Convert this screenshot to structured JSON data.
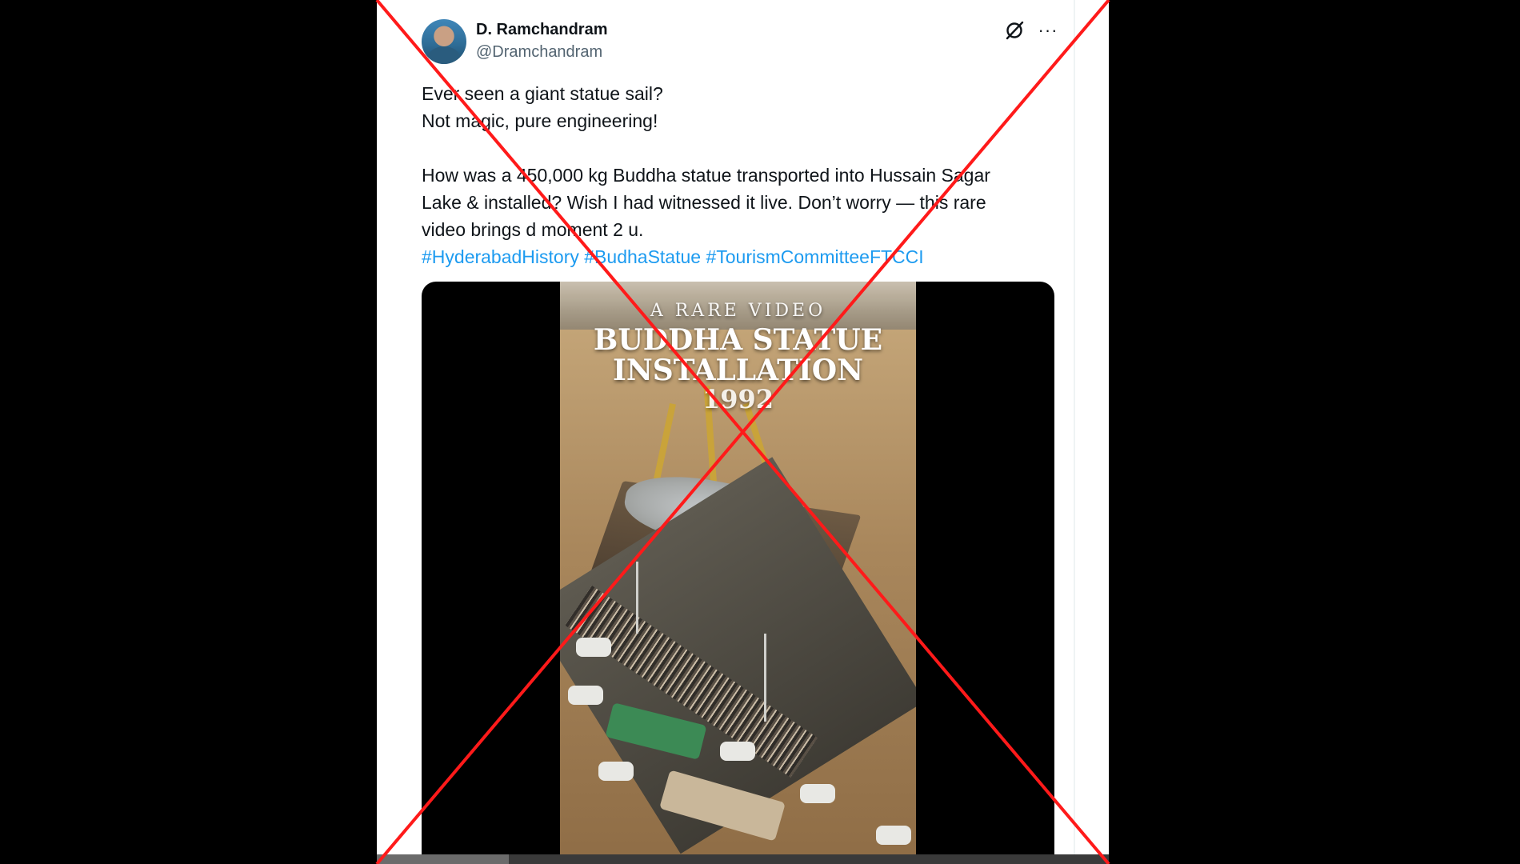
{
  "tweet": {
    "author": {
      "display_name": "D. Ramchandram",
      "handle": "@Dramchandram"
    },
    "text_lines": [
      "Ever seen a giant statue sail?",
      "Not magic, pure engineering!",
      "How was a 450,000 kg Buddha statue transported into Hussain Sagar",
      "Lake & installed? Wish I had witnessed it live. Don’t worry — this rare",
      "video brings d moment 2 u."
    ],
    "hashtags": [
      "#HyderabadHistory",
      "#BudhaStatue",
      "#TourismCommitteeFTCCI"
    ],
    "icons": {
      "grok": "grok-icon",
      "more": "more-options-icon"
    },
    "more_label": "···"
  },
  "video": {
    "overlay": {
      "subtitle": "A RARE VIDEO",
      "title_line1": "BUDDHA STATUE",
      "title_line2": "INSTALLATION",
      "year": "1992"
    },
    "progress": 0.18
  },
  "colors": {
    "link": "#1d9bf0",
    "text": "#0f1419",
    "secondary": "#536471",
    "cross": "#ff1a1a"
  }
}
